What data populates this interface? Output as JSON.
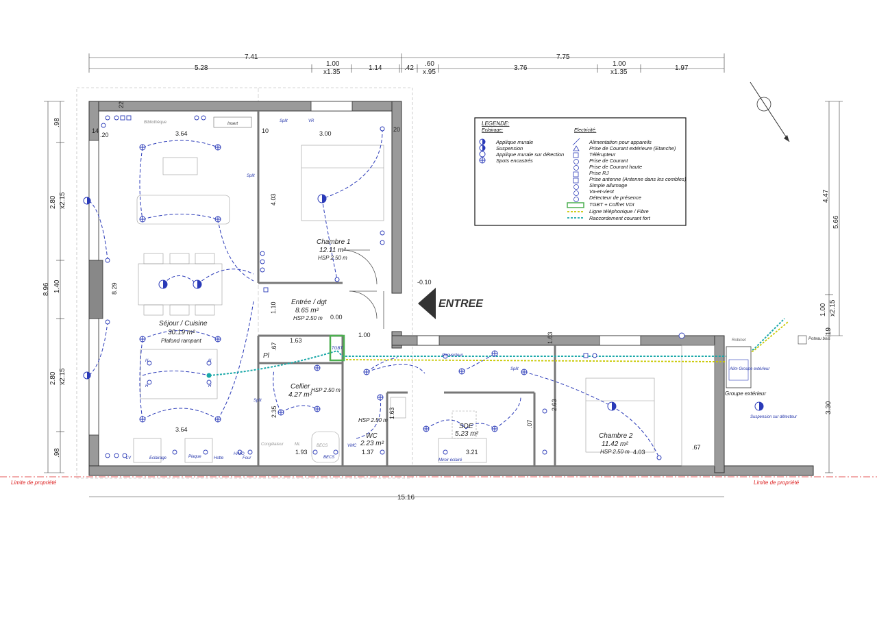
{
  "dimensions": {
    "top_total_left": "7.41",
    "top_total_right": "7.75",
    "top_segments": [
      "5.28",
      "1.00",
      "x1.35",
      "1.14",
      ".42",
      ".60",
      "x.95",
      "3.76",
      "1.00",
      "x1.35",
      "1.97"
    ],
    "bottom_total": "15.16",
    "left_total": "8.96",
    "left_segments": [
      ".98",
      "2.80",
      "x2.15",
      "1.40",
      "2.80",
      "x2.15",
      ".98"
    ],
    "right_segments": [
      "4.47",
      "5.66",
      "1.00",
      "x2.15",
      ".19",
      "3.30"
    ],
    "interior": [
      "3.64",
      "3.00",
      "4.03",
      "1.10",
      "1.63",
      "1.00",
      ".67",
      "2.35",
      "1.93",
      "1.37",
      "1.63",
      "3.21",
      "2.63",
      "4.03",
      ".67",
      "3.64",
      "8.29",
      "0.00",
      "-0.10",
      "10",
      "20",
      "22",
      "14",
      ".20",
      "1.63",
      ".07"
    ]
  },
  "rooms": [
    {
      "name": "Séjour / Cuisine",
      "area": "30.19 m²",
      "note": "Plafond rampant"
    },
    {
      "name": "Chambre 1",
      "area": "12.11 m²",
      "note": "HSP 2.50 m"
    },
    {
      "name": "Entrée / dgt",
      "area": "8.65 m²",
      "note": "HSP 2.50 m"
    },
    {
      "name": "Cellier",
      "area": "4.27 m²",
      "note": "HSP 2.50 m"
    },
    {
      "name": "WC",
      "area": "2.23 m²",
      "note": "HSP 2.50 m"
    },
    {
      "name": "SDE",
      "area": "5.23 m²",
      "note": ""
    },
    {
      "name": "Chambre 2",
      "area": "11.42 m²",
      "note": "HSP 2.50 m"
    }
  ],
  "entrance_label": "ENTREE",
  "labels": {
    "bibliotheque": "Bibliothèque",
    "insert": "Insert",
    "split": "Split",
    "pl": "Pl",
    "congelateur": "Congélateur",
    "ml": "ML",
    "becs": "BECS",
    "vmc": "VMC",
    "miroir": "Miroir éclairé",
    "convecteur": "Convecteur",
    "robinet": "Robinet",
    "poteau": "Poteau bois",
    "groupe_ext": "Groupe extérieur",
    "alim_groupe": "Alim Groupe extérieur",
    "suspension_detect": "Suspension sur détecteur",
    "lv": "LV",
    "eclairage": "Eclairage",
    "plaque": "Plaque",
    "hotte": "Hotte",
    "four": "Four",
    "hmo": "H/MO",
    "vr": "VR",
    "tgbt": "TGBT",
    "h": "H"
  },
  "property_limit": "Limite de propriété",
  "legend": {
    "title": "LEGENDE:",
    "eclairage_heading": "Eclairage:",
    "eclairage_items": [
      "Applique murale",
      "Suspension",
      "Applique murale sur détection",
      "Spots encastrés"
    ],
    "electricite_heading": "Electricité:",
    "electricite_items": [
      "Alimentation pour appareils",
      "Prise de Courant extérieure (Etanche)",
      "Télérupteur",
      "Prise de Courant",
      "Prise de Courant haute",
      "Prise RJ",
      "Prise antenne (Antenne dans les combles)",
      "Simple allumage",
      "Va-et-vient",
      "Détecteur de présence",
      "TGBT + Coffret VDI",
      "Ligne téléphonique / Fibre",
      "Raccordement courant fort"
    ]
  },
  "colors": {
    "wiring": "#2a3ab8",
    "wall": "#9a9a9a",
    "tgbt": "#4caf50",
    "fibre": "#c8c800",
    "power": "#1aa8a8",
    "arrow": "#333333",
    "limit": "#dd2222"
  }
}
